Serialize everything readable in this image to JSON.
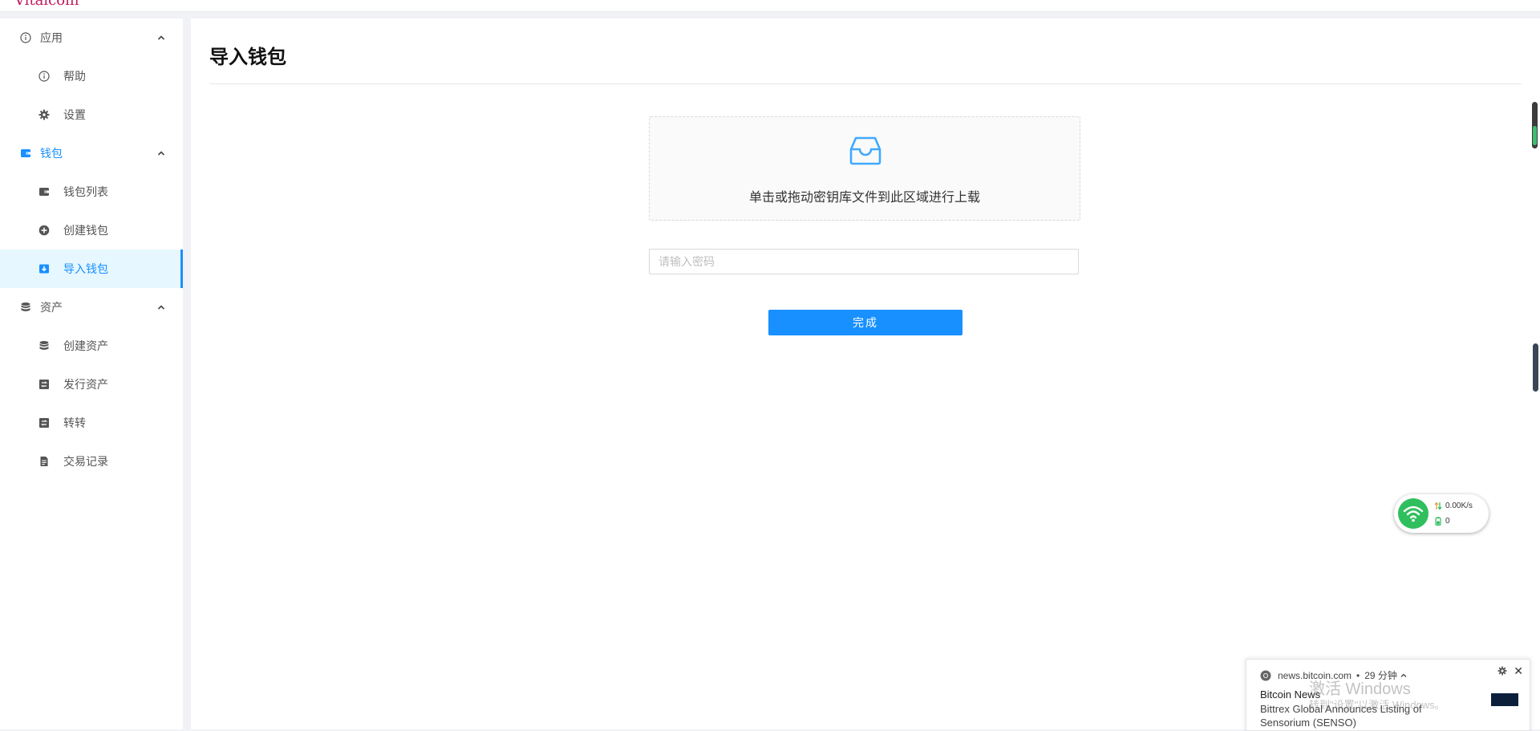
{
  "app": {
    "brand": "Vitalcoin"
  },
  "sidebar": {
    "groups": [
      {
        "label": "应用",
        "items": [
          {
            "label": "帮助"
          },
          {
            "label": "设置"
          }
        ]
      },
      {
        "label": "钱包",
        "items": [
          {
            "label": "钱包列表"
          },
          {
            "label": "创建钱包"
          },
          {
            "label": "导入钱包"
          }
        ]
      },
      {
        "label": "资产",
        "items": [
          {
            "label": "创建资产"
          },
          {
            "label": "发行资产"
          },
          {
            "label": "转转"
          },
          {
            "label": "交易记录"
          }
        ]
      }
    ],
    "selected": "导入钱包"
  },
  "page": {
    "title": "导入钱包",
    "upload_hint": "单击或拖动密钥库文件到此区域进行上载",
    "password_placeholder": "请输入密码",
    "password_value": "",
    "submit_label": "完成"
  },
  "colors": {
    "primary": "#1890ff",
    "selected_bg": "#e6f7ff",
    "net_green": "#2fbf5e"
  },
  "net_widget": {
    "speed": "0.00K/s",
    "count": "0"
  },
  "notification": {
    "source": "news.bitcoin.com",
    "time": "29 分钟",
    "title": "Bitcoin News",
    "body": "Bittrex Global Announces Listing of Sensorium (SENSO)",
    "watermark_title": "激活 Windows",
    "watermark_sub": "转到\"设置\"以激活 Windows。"
  }
}
